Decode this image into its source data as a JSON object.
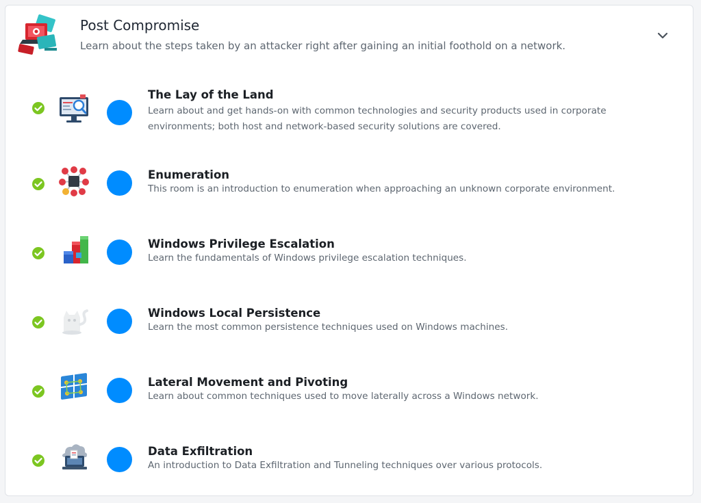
{
  "module": {
    "title": "Post Compromise",
    "description": "Learn about the steps taken by an attacker right after gaining an initial foothold on a network.",
    "icon": "red-laptops-icon",
    "toggle_icon": "chevron-down-icon",
    "expanded": true
  },
  "colors": {
    "accent_blue": "#008cff",
    "check_green": "#7cc621",
    "title_text": "#1b1f24",
    "body_text": "#5d6670"
  },
  "rooms": [
    {
      "title": "The Lay of the Land",
      "description": "Learn about and get hands-on with common technologies and security products used in corporate environments; both host and network-based security solutions are covered.",
      "icon": "monitor-magnifier-icon",
      "completed": true
    },
    {
      "title": "Enumeration",
      "description": "This room is an introduction to enumeration when approaching an unknown corporate environment.",
      "icon": "network-nodes-icon",
      "completed": true
    },
    {
      "title": "Windows Privilege Escalation",
      "description": "Learn the fundamentals of Windows privilege escalation techniques.",
      "icon": "stacked-cubes-icon",
      "completed": true
    },
    {
      "title": "Windows Local Persistence",
      "description": "Learn the most common persistence techniques used on Windows machines.",
      "icon": "ghost-cat-icon",
      "completed": true
    },
    {
      "title": "Lateral Movement and Pivoting",
      "description": "Learn about common techniques used to move laterally across a Windows network.",
      "icon": "windows-network-icon",
      "completed": true
    },
    {
      "title": "Data Exfiltration",
      "description": "An introduction to Data Exfiltration and Tunneling techniques over various protocols.",
      "icon": "cloud-server-icon",
      "completed": true
    }
  ]
}
